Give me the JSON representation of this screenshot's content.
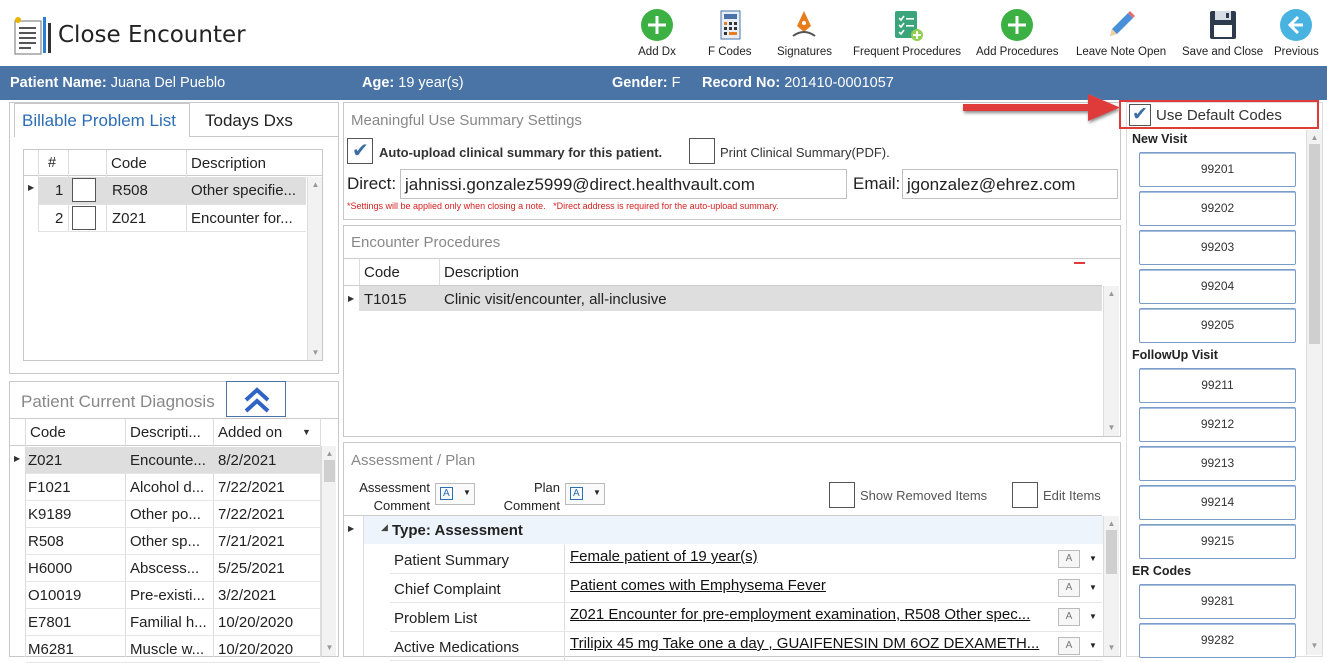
{
  "app": {
    "title": "Close Encounter",
    "icon": "document-list-icon"
  },
  "toolbar": [
    {
      "label": "Add Dx",
      "icon": "plus-circle-icon"
    },
    {
      "label": "F Codes",
      "icon": "calculator-icon"
    },
    {
      "label": "Signatures",
      "icon": "pen-nib-icon"
    },
    {
      "label": "Frequent Procedures",
      "icon": "checklist-plus-icon"
    },
    {
      "label": "Add Procedures",
      "icon": "plus-circle-icon"
    },
    {
      "label": "Leave Note Open",
      "icon": "pencil-icon"
    },
    {
      "label": "Save and Close",
      "icon": "floppy-disk-icon"
    },
    {
      "label": "Previous",
      "icon": "arrow-left-circle-icon"
    }
  ],
  "patient": {
    "name_label": "Patient Name:",
    "name": "Juana Del Pueblo",
    "age_label": "Age:",
    "age": "19 year(s)",
    "gender_label": "Gender:",
    "gender": "F",
    "record_label": "Record No:",
    "record": "201410-0001057"
  },
  "billable": {
    "tabs": [
      "Billable Problem List",
      "Todays Dxs"
    ],
    "headers": [
      "#",
      "Code",
      "Description"
    ],
    "rows": [
      {
        "num": "1",
        "code": "R508",
        "desc": "Other specifie..."
      },
      {
        "num": "2",
        "code": "Z021",
        "desc": "Encounter for..."
      }
    ]
  },
  "current_dx": {
    "title": "Patient Current Diagnosis",
    "headers": [
      "Code",
      "Descripti...",
      "Added on"
    ],
    "rows": [
      {
        "code": "Z021",
        "desc": "Encounte...",
        "date": "8/2/2021"
      },
      {
        "code": "F1021",
        "desc": "Alcohol d...",
        "date": "7/22/2021"
      },
      {
        "code": "K9189",
        "desc": "Other po...",
        "date": "7/22/2021"
      },
      {
        "code": "R508",
        "desc": "Other sp...",
        "date": "7/21/2021"
      },
      {
        "code": "H6000",
        "desc": "Abscess...",
        "date": "5/25/2021"
      },
      {
        "code": "O10019",
        "desc": "Pre-existi...",
        "date": "3/2/2021"
      },
      {
        "code": "E7801",
        "desc": "Familial h...",
        "date": "10/20/2020"
      },
      {
        "code": "M6281",
        "desc": "Muscle w...",
        "date": "10/20/2020"
      }
    ]
  },
  "mu": {
    "title": "Meaningful Use Summary Settings",
    "auto_upload_label": "Auto-upload clinical summary for this patient.",
    "print_label": "Print Clinical Summary(PDF).",
    "direct_label": "Direct:",
    "direct_value": "jahnissi.gonzalez5999@direct.healthvault.com",
    "email_label": "Email:",
    "email_value": "jgonzalez@ehrez.com",
    "note": "*Settings will be applied only when closing a note.   *Direct address is required for the auto-upload summary."
  },
  "procedures": {
    "title": "Encounter Procedures",
    "headers": [
      "Code",
      "Description"
    ],
    "rows": [
      {
        "code": "T1015",
        "desc": "Clinic visit/encounter, all-inclusive"
      }
    ]
  },
  "assessment": {
    "title": "Assessment / Plan",
    "assessment_comment": "Assessment\nComment",
    "assessment_comment_l1": "Assessment",
    "assessment_comment_l2": "Comment",
    "plan_comment_l1": "Plan",
    "plan_comment_l2": "Comment",
    "show_removed": "Show Removed Items",
    "edit_items": "Edit Items",
    "group_label": "Type: Assessment",
    "rows": [
      {
        "label": "Patient Summary",
        "value": "Female patient of 19 year(s)"
      },
      {
        "label": "Chief Complaint",
        "value": "Patient comes with  Emphysema  Fever "
      },
      {
        "label": "Problem List",
        "value": "Z021 Encounter for pre-employment examination, R508 Other spec..."
      },
      {
        "label": "Active Medications",
        "value": "Trilipix 45 mg Take one a day , GUAIFENESIN DM 6OZ  DEXAMETH..."
      }
    ]
  },
  "codes": {
    "use_default_label": "Use Default Codes",
    "sections": [
      {
        "title": "New Visit",
        "codes": [
          "99201",
          "99202",
          "99203",
          "99204",
          "99205"
        ]
      },
      {
        "title": "FollowUp Visit",
        "codes": [
          "99211",
          "99212",
          "99213",
          "99214",
          "99215"
        ]
      },
      {
        "title": "ER Codes",
        "codes": [
          "99281",
          "99282"
        ]
      }
    ]
  },
  "colors": {
    "header_bar": "#4a74a6",
    "highlight_border": "#e03b3b",
    "accent": "#3b6ea5"
  }
}
